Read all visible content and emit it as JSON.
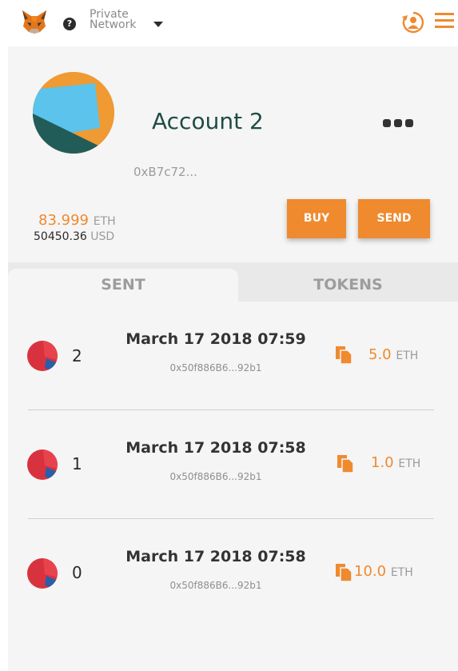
{
  "header": {
    "network_line1": "Private",
    "network_line2": "Network",
    "help_glyph": "?",
    "icons": [
      "metamask-fox-icon",
      "help-icon",
      "chevron-down-icon",
      "account-switch-icon",
      "hamburger-menu-icon"
    ]
  },
  "account": {
    "name": "Account 2",
    "address": "0xB7c72...",
    "balance_eth": "83.999",
    "balance_eth_unit": "ETH",
    "balance_usd": "50450.36",
    "balance_usd_unit": "USD",
    "buy_label": "BUY",
    "send_label": "SEND"
  },
  "tabs": [
    {
      "label": "SENT",
      "active": true
    },
    {
      "label": "TOKENS",
      "active": false
    }
  ],
  "transactions": [
    {
      "nonce": "2",
      "date": "March 17 2018 07:59",
      "hash": "0x50f886B6...92b1",
      "amount": "5.0",
      "unit": "ETH"
    },
    {
      "nonce": "1",
      "date": "March 17 2018 07:58",
      "hash": "0x50f886B6...92b1",
      "amount": "1.0",
      "unit": "ETH"
    },
    {
      "nonce": "0",
      "date": "March 17 2018 07:58",
      "hash": "0x50f886B6...92b1",
      "amount": "10.0",
      "unit": "ETH"
    }
  ],
  "colors": {
    "accent": "#ef8a2f",
    "account_name": "#1e4d44",
    "panel_bg": "#f5f5f5",
    "tx_icon_red": "#d9323f"
  }
}
